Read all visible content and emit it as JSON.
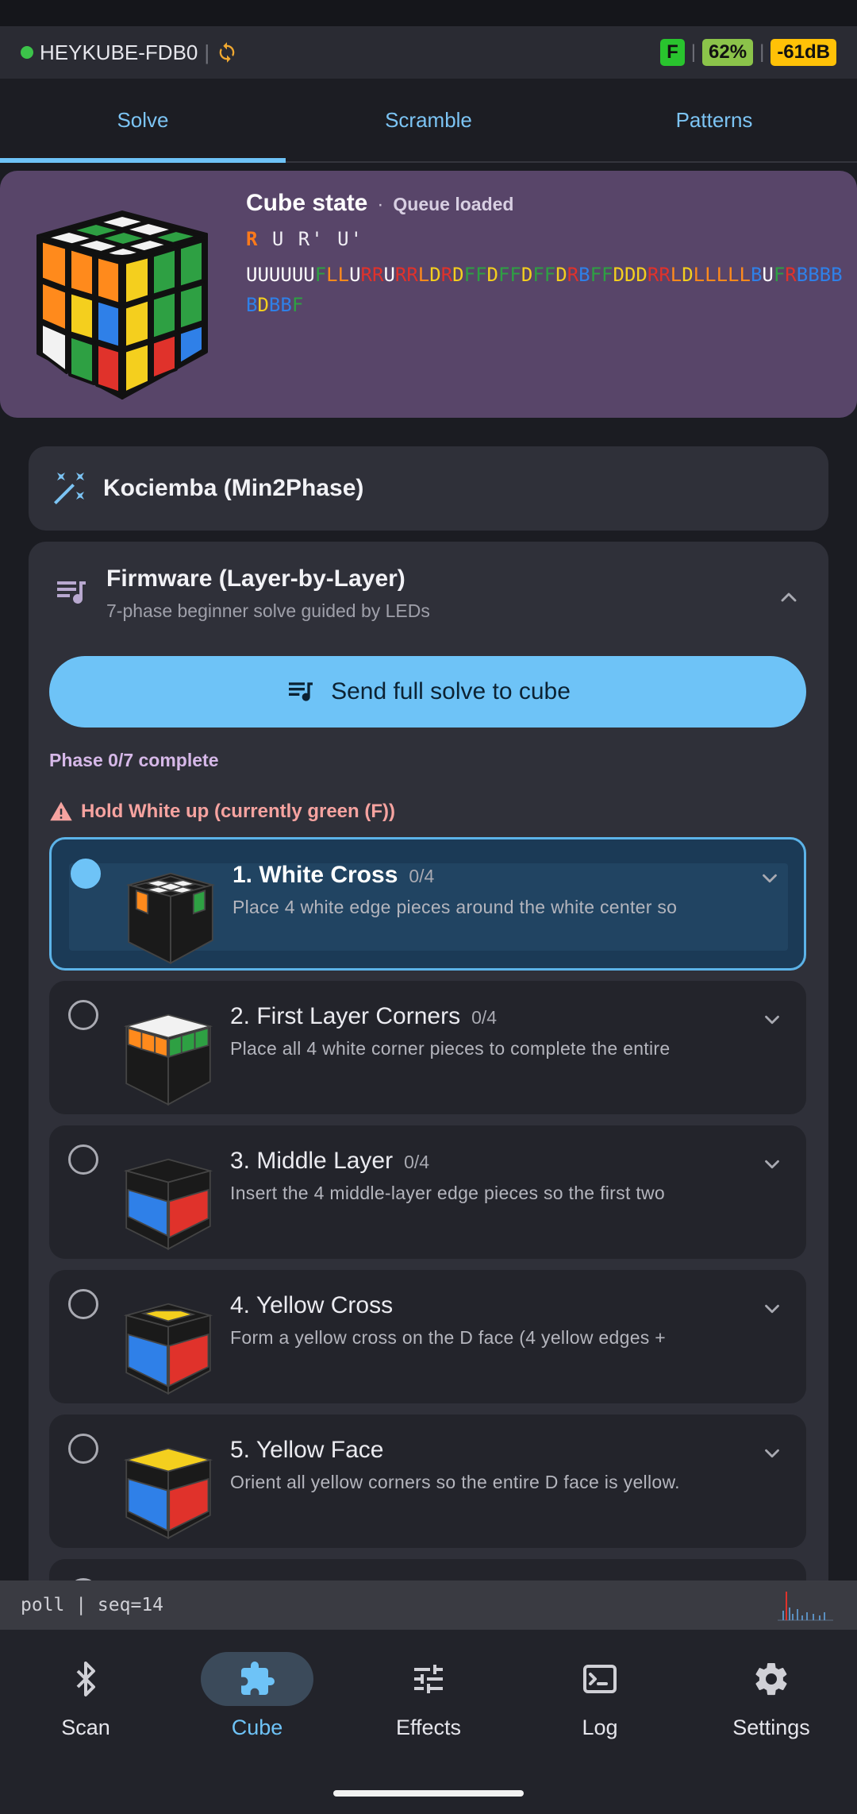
{
  "topbar": {
    "device_name": "HEYKUBE-FDB0",
    "separator": "|",
    "face_badge": "F",
    "battery": "62%",
    "signal": "-61dB",
    "colors": {
      "connected": "#3cc34a",
      "face": "#29c42e",
      "battery": "#8bc34a",
      "signal": "#ffc107"
    }
  },
  "tabs": [
    {
      "label": "Solve",
      "active": true
    },
    {
      "label": "Scramble",
      "active": false
    },
    {
      "label": "Patterns",
      "active": false
    }
  ],
  "cube_state": {
    "title": "Cube state",
    "dot": "·",
    "status": "Queue loaded",
    "moves_highlight": "R",
    "moves_rest": " U R' U'",
    "facelets": "UUUUUUFLLURRURRLDRDFFDFFDFFDRBFFDDDRRLDLLLLLBUFRBBBBBDBBF"
  },
  "solver": {
    "name": "Kociemba (Min2Phase)",
    "icon": "magic-wand-icon"
  },
  "firmware": {
    "title": "Firmware (Layer-by-Layer)",
    "subtitle": "7-phase beginner solve guided by LEDs",
    "send_label": "Send full solve to cube",
    "progress": "Phase 0/7 complete",
    "warning": "Hold White up (currently green (F))"
  },
  "phases": [
    {
      "title": "1. White Cross",
      "count": "0/4",
      "desc": "Place 4 white edge pieces around the white center so",
      "active": true
    },
    {
      "title": "2. First Layer Corners",
      "count": "0/4",
      "desc": "Place all 4 white corner pieces to complete the entire",
      "active": false
    },
    {
      "title": "3. Middle Layer",
      "count": "0/4",
      "desc": "Insert the 4 middle-layer edge pieces so the first two",
      "active": false
    },
    {
      "title": "4. Yellow Cross",
      "count": "",
      "desc": "Form a yellow cross on the D face (4 yellow edges +",
      "active": false
    },
    {
      "title": "5. Yellow Face",
      "count": "",
      "desc": "Orient all yellow corners so the entire D face is yellow.",
      "active": false
    }
  ],
  "console": {
    "text": "poll | seq=14"
  },
  "nav": [
    {
      "label": "Scan",
      "icon": "bluetooth-icon"
    },
    {
      "label": "Cube",
      "icon": "puzzle-icon",
      "active": true
    },
    {
      "label": "Effects",
      "icon": "sliders-icon"
    },
    {
      "label": "Log",
      "icon": "terminal-icon"
    },
    {
      "label": "Settings",
      "icon": "gear-icon"
    }
  ]
}
